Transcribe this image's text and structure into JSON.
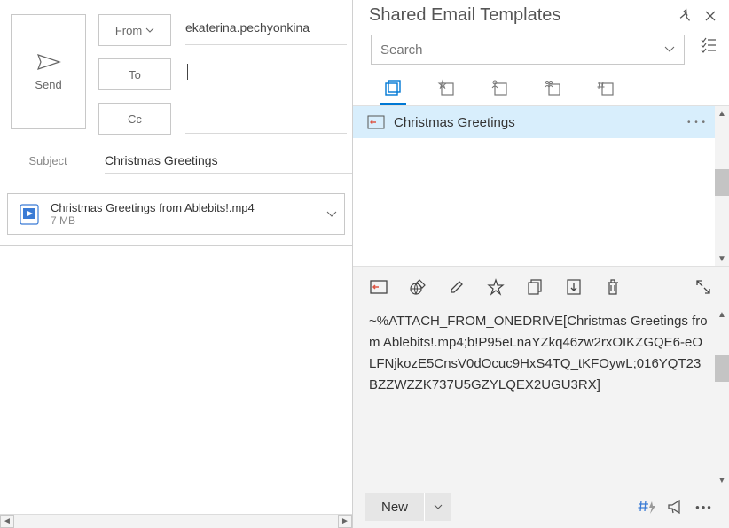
{
  "compose": {
    "send_label": "Send",
    "from_button": "From",
    "to_button": "To",
    "cc_button": "Cc",
    "from_value": "ekaterina.pechyonkina",
    "to_value": "",
    "cc_value": "",
    "subject_label": "Subject",
    "subject_value": "Christmas Greetings",
    "attachment": {
      "name": "Christmas Greetings from Ablebits!.mp4",
      "size": "7 MB"
    }
  },
  "panel": {
    "title": "Shared Email Templates",
    "search_placeholder": "Search",
    "templates": [
      {
        "name": "Christmas Greetings"
      }
    ],
    "content_text": "~%ATTACH_FROM_ONEDRIVE[Christmas Greetings from Ablebits!.mp4;b!P95eLnaYZkq46zw2rxOIKZGQE6-eOLFNjkozE5CnsV0dOcuc9HxS4TQ_tKFOywL;016YQT23BZZWZZK737U5GZYLQEX2UGU3RX]",
    "new_button": "New"
  },
  "icons": {
    "dots": "• • •"
  }
}
